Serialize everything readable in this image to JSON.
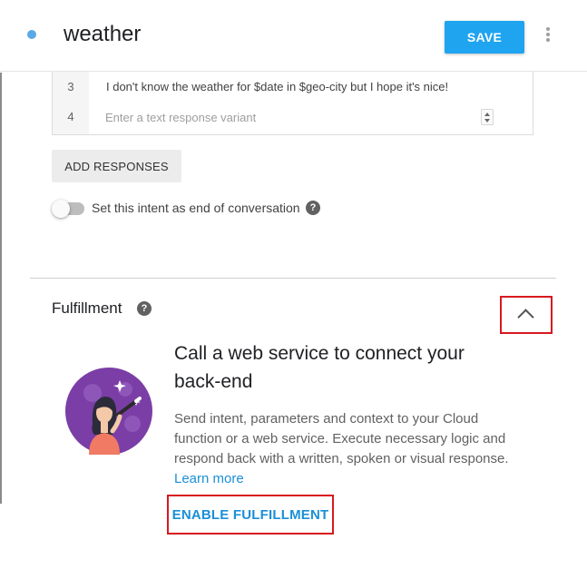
{
  "header": {
    "title": "weather",
    "save_label": "SAVE",
    "menu_icon": "more-vert-icon"
  },
  "responses": {
    "rows": [
      {
        "number": "3",
        "text": "I don't know the weather for $date in $geo-city but I hope it's nice!"
      },
      {
        "number": "4",
        "placeholder": "Enter a text response variant"
      }
    ],
    "add_label": "ADD RESPONSES"
  },
  "end_conversation": {
    "label": "Set this intent as end of conversation",
    "enabled": false
  },
  "fulfillment": {
    "title": "Fulfillment",
    "heading": "Call a web service to connect your back-end",
    "description": "Send intent, parameters and context to your Cloud function or a web service. Execute necessary logic and respond back with a written, spoken or visual response.",
    "learn_more": "Learn more",
    "enable_label": "ENABLE FULFILLMENT",
    "help_glyph": "?"
  },
  "colors": {
    "accent": "#1fa4f0",
    "link": "#1a8fd8",
    "highlight": "#d71920",
    "illustration_bg": "#7b3ea6"
  }
}
